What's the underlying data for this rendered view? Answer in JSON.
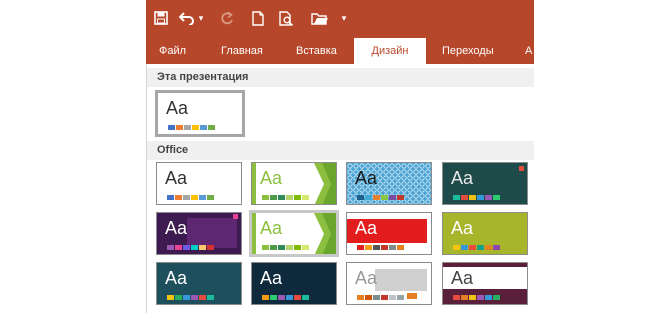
{
  "quick_access": {
    "save_icon": "save-icon",
    "undo_icon": "undo-icon",
    "undo_dropdown_glyph": "▾",
    "redo_icon": "redo-icon",
    "new_icon": "new-document-icon",
    "print_preview_icon": "print-preview-icon",
    "open_icon": "open-folder-icon",
    "customize_glyph": "▾"
  },
  "ribbon": {
    "tabs": [
      {
        "label": "Файл",
        "active": false
      },
      {
        "label": "Главная",
        "active": false
      },
      {
        "label": "Вставка",
        "active": false
      },
      {
        "label": "Дизайн",
        "active": true
      },
      {
        "label": "Переходы",
        "active": false
      },
      {
        "label": "А",
        "active": false
      }
    ]
  },
  "gallery": {
    "section_this": "Эта презентация",
    "section_office": "Office",
    "current_theme": {
      "sample": "Aa",
      "bg": "#ffffff",
      "fg": "#333333",
      "swatches": [
        "#4472c4",
        "#ed7d31",
        "#a5a5a5",
        "#ffc000",
        "#5b9bd5",
        "#70ad47"
      ]
    },
    "themes": [
      {
        "sample": "Aa",
        "bg": "#ffffff",
        "fg": "#333333",
        "accent": "none",
        "swatches": [
          "#4472c4",
          "#ed7d31",
          "#a5a5a5",
          "#ffc000",
          "#5b9bd5",
          "#70ad47"
        ]
      },
      {
        "sample": "Aa",
        "bg": "#ffffff",
        "fg": "#8cbf3f",
        "accent": "green-chevron",
        "swatches": [
          "#8cbf3f",
          "#4f9a46",
          "#2e8b57",
          "#b5d56a",
          "#7fba00",
          "#d8e96b"
        ]
      },
      {
        "sample": "Aa",
        "bg": "#4aa3d4",
        "fg": "#1a1a1a",
        "accent": "pattern",
        "swatches": [
          "#1f5f8b",
          "#3fa9d8",
          "#e97f2e",
          "#8dc63f",
          "#7a4b9c",
          "#c0392b"
        ]
      },
      {
        "sample": "Aa",
        "bg": "#1f4a4a",
        "fg": "#e8e8e8",
        "accent": "red-corner",
        "swatches": [
          "#1abc9c",
          "#e74c3c",
          "#f1c40f",
          "#3498db",
          "#9b59b6",
          "#2ecc71"
        ]
      },
      {
        "sample": "Aa",
        "bg": "#5b2a6e",
        "fg": "#ffffff",
        "accent": "purple",
        "swatches": [
          "#9b59b6",
          "#e84393",
          "#6c5ce7",
          "#00cec9",
          "#fdcb6e",
          "#d63031"
        ]
      },
      {
        "sample": "Aa",
        "bg": "#ffffff",
        "fg": "#8cbf3f",
        "accent": "green-chevron",
        "swatches": [
          "#8cbf3f",
          "#4f9a46",
          "#2e8b57",
          "#b5d56a",
          "#7fba00",
          "#d8e96b"
        ]
      },
      {
        "sample": "Aa",
        "bg": "#ffffff",
        "fg": "#ffffff",
        "accent": "red-band",
        "swatches": [
          "#e31d1d",
          "#f39c12",
          "#555555",
          "#c0392b",
          "#7f8c8d",
          "#e67e22"
        ]
      },
      {
        "sample": "Aa",
        "bg": "#a6b52a",
        "fg": "#ffffff",
        "accent": "none",
        "swatches": [
          "#f1c40f",
          "#3498db",
          "#e74c3c",
          "#16a085",
          "#e67e22",
          "#8e44ad"
        ]
      },
      {
        "sample": "Aa",
        "bg": "#1d4f5c",
        "fg": "#ffffff",
        "accent": "none",
        "swatches": [
          "#f1c40f",
          "#27ae60",
          "#3498db",
          "#9b59b6",
          "#e74c3c",
          "#1abc9c"
        ]
      },
      {
        "sample": "Aa",
        "bg": "#102a3d",
        "fg": "#ffffff",
        "accent": "none",
        "swatches": [
          "#f39c12",
          "#2ecc71",
          "#9b59b6",
          "#3498db",
          "#e74c3c",
          "#1abc9c"
        ]
      },
      {
        "sample": "Aa",
        "bg": "#ffffff",
        "fg": "#999999",
        "accent": "gray-texture",
        "swatches": [
          "#e67e22",
          "#d35400",
          "#7f8c8d",
          "#c0392b",
          "#bdc3c7",
          "#95a5a6"
        ]
      },
      {
        "sample": "Aa",
        "bg": "#ffffff",
        "fg": "#444444",
        "accent": "maroon-band",
        "swatches": [
          "#e74c3c",
          "#e67e22",
          "#f1c40f",
          "#9b59b6",
          "#3498db",
          "#27ae60"
        ]
      }
    ]
  }
}
